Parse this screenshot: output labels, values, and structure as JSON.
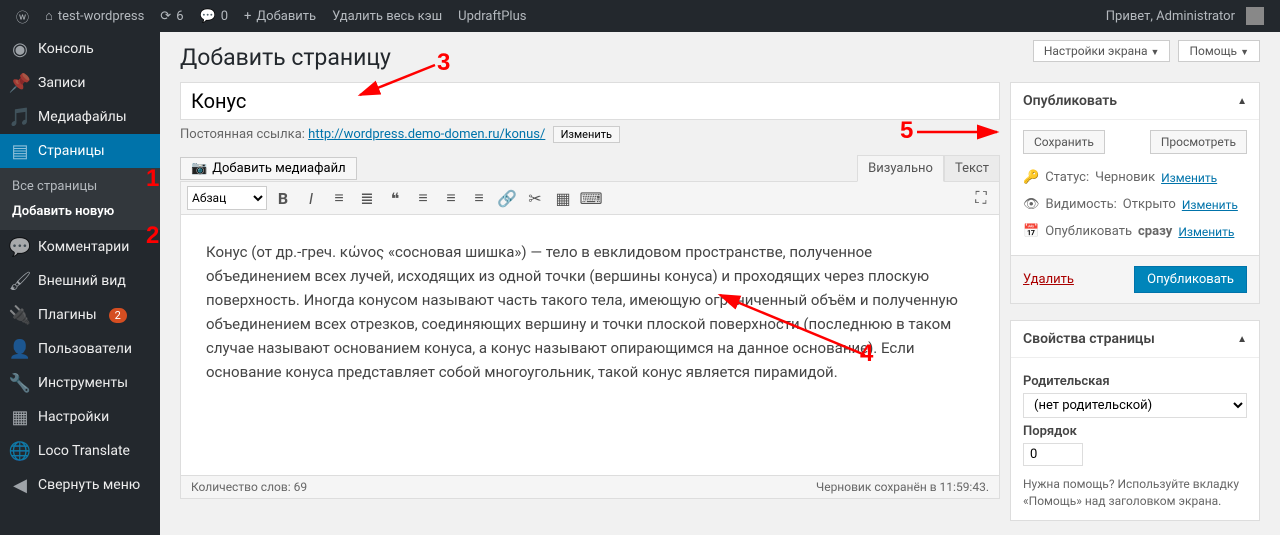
{
  "adminbar": {
    "site": "test-wordpress",
    "updates": "6",
    "comments": "0",
    "add": "Добавить",
    "clear_cache": "Удалить весь кэш",
    "updraft": "UpdraftPlus",
    "greeting": "Привет, Administrator"
  },
  "sidebar": {
    "items": [
      {
        "icon": "dashboard",
        "label": "Консоль"
      },
      {
        "icon": "pin",
        "label": "Записи"
      },
      {
        "icon": "media",
        "label": "Медиафайлы"
      },
      {
        "icon": "page",
        "label": "Страницы",
        "current": true
      },
      {
        "icon": "comment",
        "label": "Комментарии"
      },
      {
        "icon": "brush",
        "label": "Внешний вид"
      },
      {
        "icon": "plugin",
        "label": "Плагины",
        "badge": "2"
      },
      {
        "icon": "user",
        "label": "Пользователи"
      },
      {
        "icon": "wrench",
        "label": "Инструменты"
      },
      {
        "icon": "settings",
        "label": "Настройки"
      },
      {
        "icon": "loco",
        "label": "Loco Translate"
      },
      {
        "icon": "collapse",
        "label": "Свернуть меню"
      }
    ],
    "sub": [
      "Все страницы",
      "Добавить новую"
    ],
    "sub_current": 1
  },
  "top_buttons": {
    "screen_options": "Настройки экрана",
    "help": "Помощь"
  },
  "page": {
    "heading": "Добавить страницу",
    "title_value": "Конус",
    "permalink_label": "Постоянная ссылка:",
    "permalink_url": "http://wordpress.demo-domen.ru/konus/",
    "permalink_edit": "Изменить",
    "add_media": "Добавить медиафайл",
    "tab_visual": "Визуально",
    "tab_text": "Текст",
    "para_select": "Абзац",
    "body": "Конус (от др.-греч. κώνος «сосновая шишка») — тело в евклидовом пространстве, полученное объединением всех лучей, исходящих из одной точки (вершины конуса) и проходящих через плоскую поверхность. Иногда конусом называют часть такого тела, имеющую ограниченный объём и полученную объединением всех отрезков, соединяющих вершину и точки плоской поверхности (последнюю в таком случае называют основанием конуса, а конус называют опирающимся на данное основание). Если основание конуса представляет собой многоугольник, такой конус является пирамидой.",
    "word_count": "Количество слов: 69",
    "saved": "Черновик сохранён в 11:59:43."
  },
  "publish": {
    "title": "Опубликовать",
    "save": "Сохранить",
    "preview": "Просмотреть",
    "status_label": "Статус:",
    "status_value": "Черновик",
    "status_edit": "Изменить",
    "vis_label": "Видимость:",
    "vis_value": "Открыто",
    "vis_edit": "Изменить",
    "sched_label": "Опубликовать",
    "sched_value": "сразу",
    "sched_edit": "Изменить",
    "delete": "Удалить",
    "submit": "Опубликовать"
  },
  "attrs": {
    "title": "Свойства страницы",
    "parent_label": "Родительская",
    "parent_value": "(нет родительской)",
    "order_label": "Порядок",
    "order_value": "0",
    "help": "Нужна помощь? Используйте вкладку «Помощь» над заголовком экрана."
  },
  "annotations": {
    "a1": "1",
    "a2": "2",
    "a3": "3",
    "a4": "4",
    "a5": "5"
  }
}
